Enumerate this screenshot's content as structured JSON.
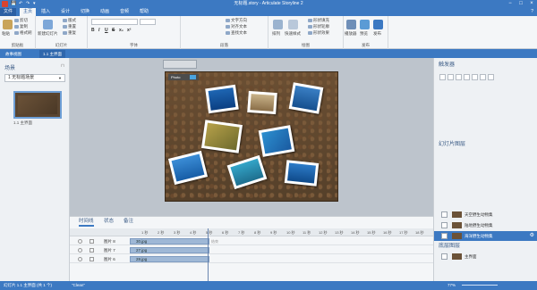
{
  "window": {
    "title": "无标题.story - Articulate Storyline 2",
    "minimize": "−",
    "maximize": "□",
    "close": "×"
  },
  "quick_access": {
    "save": "💾",
    "undo": "↶",
    "redo": "↷",
    "more": "▾"
  },
  "menu": {
    "file": "文件",
    "items": [
      "主页",
      "插入",
      "设计",
      "切换",
      "动画",
      "音频",
      "帮助"
    ],
    "active": "主页",
    "help_icon": "?"
  },
  "ribbon": {
    "clipboard": {
      "paste": "粘贴",
      "cut": "剪切",
      "copy": "复制",
      "format_painter": "格式刷",
      "label": "剪贴板"
    },
    "slide": {
      "new_slide": "新建幻灯片",
      "layout": "版式",
      "reset": "重置",
      "duplicate": "重复",
      "label": "幻灯片"
    },
    "font": {
      "label": "字体",
      "bold": "B",
      "italic": "I",
      "underline": "U",
      "strike": "S",
      "sub": "x₂",
      "sup": "x²"
    },
    "paragraph": {
      "label": "段落",
      "text_direction": "文字方向",
      "align_text": "对齐文本",
      "find_text": "查找文本"
    },
    "drawing": {
      "label": "绘图",
      "arrange": "排列",
      "quick_styles": "快速样式",
      "shape_fill": "形状填充",
      "shape_outline": "形状轮廓",
      "shape_effects": "形状效果"
    },
    "publish": {
      "label": "发布",
      "player": "播放器",
      "preview": "预览",
      "publish": "发布"
    }
  },
  "doc_tabs": [
    {
      "label": "故事视图"
    },
    {
      "label": "1.1 主界面"
    }
  ],
  "scenes": {
    "title": "场景",
    "selected": "1 无标题场景",
    "thumb_label": "1.1 主界面"
  },
  "slide": {
    "photo_label": "Photo"
  },
  "triggers": {
    "title": "触发器"
  },
  "layers": {
    "title": "幻灯片图层",
    "items": [
      {
        "name": "天空野生动物集",
        "selected": false
      },
      {
        "name": "陆地野生动物集",
        "selected": false
      },
      {
        "name": "海洋野生动物集",
        "selected": true
      }
    ],
    "base_title": "底层图层",
    "base_item": "主界面"
  },
  "timeline": {
    "tabs": [
      "时间线",
      "状态",
      "备注"
    ],
    "active_tab": "时间线",
    "ticks": [
      "1 秒",
      "2 秒",
      "3 秒",
      "4 秒",
      "5 秒",
      "6 秒",
      "7 秒",
      "8 秒",
      "9 秒",
      "10 秒",
      "11 秒",
      "12 秒",
      "13 秒",
      "14 秒",
      "15 秒",
      "16 秒",
      "17 秒",
      "18 秒"
    ],
    "end_label": "结束",
    "rows": [
      {
        "name": "图片 8",
        "file": "30.jpg"
      },
      {
        "name": "图片 7",
        "file": "27.jpg"
      },
      {
        "name": "图片 6",
        "file": "28.jpg"
      }
    ]
  },
  "status": {
    "slide_info": "幻灯片 1.1 主界面 (共 1 个)",
    "theme": "\"Clean\"",
    "zoom": "77%"
  },
  "colors": {
    "accent": "#3c79c2",
    "slide_bg": "#5e452d"
  }
}
